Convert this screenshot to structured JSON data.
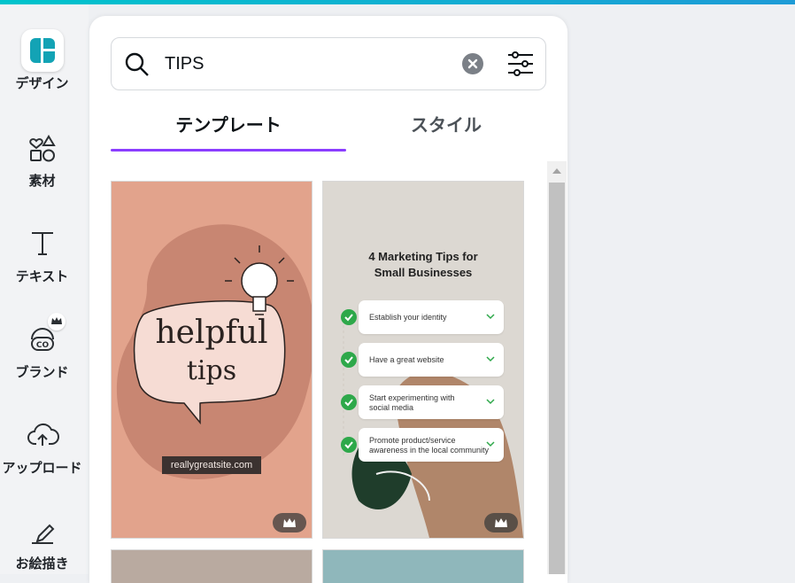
{
  "sidebar": {
    "items": [
      {
        "label": "デザイン",
        "icon": "design-icon"
      },
      {
        "label": "素材",
        "icon": "elements-icon"
      },
      {
        "label": "テキスト",
        "icon": "text-icon"
      },
      {
        "label": "ブランド",
        "icon": "brand-icon"
      },
      {
        "label": "アップロード",
        "icon": "upload-icon"
      },
      {
        "label": "お絵描き",
        "icon": "draw-icon"
      }
    ]
  },
  "search": {
    "value": "TIPS"
  },
  "tabs": [
    {
      "label": "テンプレート",
      "active": true
    },
    {
      "label": "スタイル",
      "active": false
    }
  ],
  "templates": {
    "card1": {
      "line1": "helpful",
      "line2": "tips",
      "site": "reallygreatsite.com",
      "premium": true
    },
    "card2": {
      "title_line1": "4 Marketing Tips for",
      "title_line2": "Small Businesses",
      "tips": [
        [
          "Establish your identity"
        ],
        [
          "Have a great website"
        ],
        [
          "Start experimenting with",
          "social media"
        ],
        [
          "Promote product/service",
          "awareness in the local community"
        ]
      ],
      "premium": true
    }
  },
  "colors": {
    "accent": "#8b3dff",
    "brand_gradient_start": "#00c4cc",
    "check_green": "#2ea84a"
  }
}
